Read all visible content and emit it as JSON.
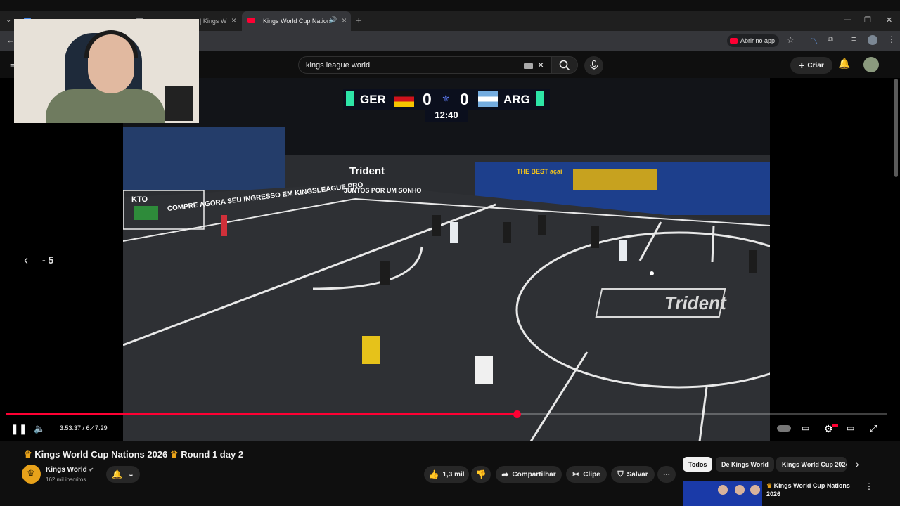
{
  "browser": {
    "tabs": [
      {
        "label": "",
        "active": false
      },
      {
        "label": "| Kings W",
        "active": false
      },
      {
        "label": "Kings World Cup Nation",
        "active": true
      }
    ],
    "new_tab": "+",
    "open_in_app": "Abrir no app"
  },
  "youtube": {
    "search_query": "kings league world",
    "create_label": "Criar"
  },
  "video": {
    "scoreboard": {
      "home_team": "GER",
      "home_score": "0",
      "away_team": "ARG",
      "away_score": "0",
      "clock": "12:40"
    },
    "seek_label": "- 5",
    "progress": 0.58,
    "time_current": "3:53:37",
    "time_separator": " / ",
    "time_total": "6:47:29",
    "field_brand": "Trident",
    "banner_text": "COMPRE AGORA SEU INGRESSO EM KINGSLEAGUE.PRO",
    "ad_text": "JUNTOS POR UM SONHO",
    "board_text": "THE BEST açaí",
    "kto": "KTO"
  },
  "metadata": {
    "title_part1": "Kings World Cup Nations 2026",
    "title_part2": "Round 1 day 2",
    "channel_name": "Kings World",
    "subscribers": "162 mil inscritos",
    "likes": "1,3 mil",
    "share": "Compartilhar",
    "clip": "Clipe",
    "save": "Salvar"
  },
  "chips": [
    "Todos",
    "De Kings World",
    "Kings World Cup 2024"
  ],
  "recommended": {
    "title_line1": "Kings World Cup Nations",
    "title_line2": "2026"
  },
  "colors": {
    "accent": "#ff0033",
    "background": "#0f0f0f",
    "pitch": "#2b2d31"
  }
}
